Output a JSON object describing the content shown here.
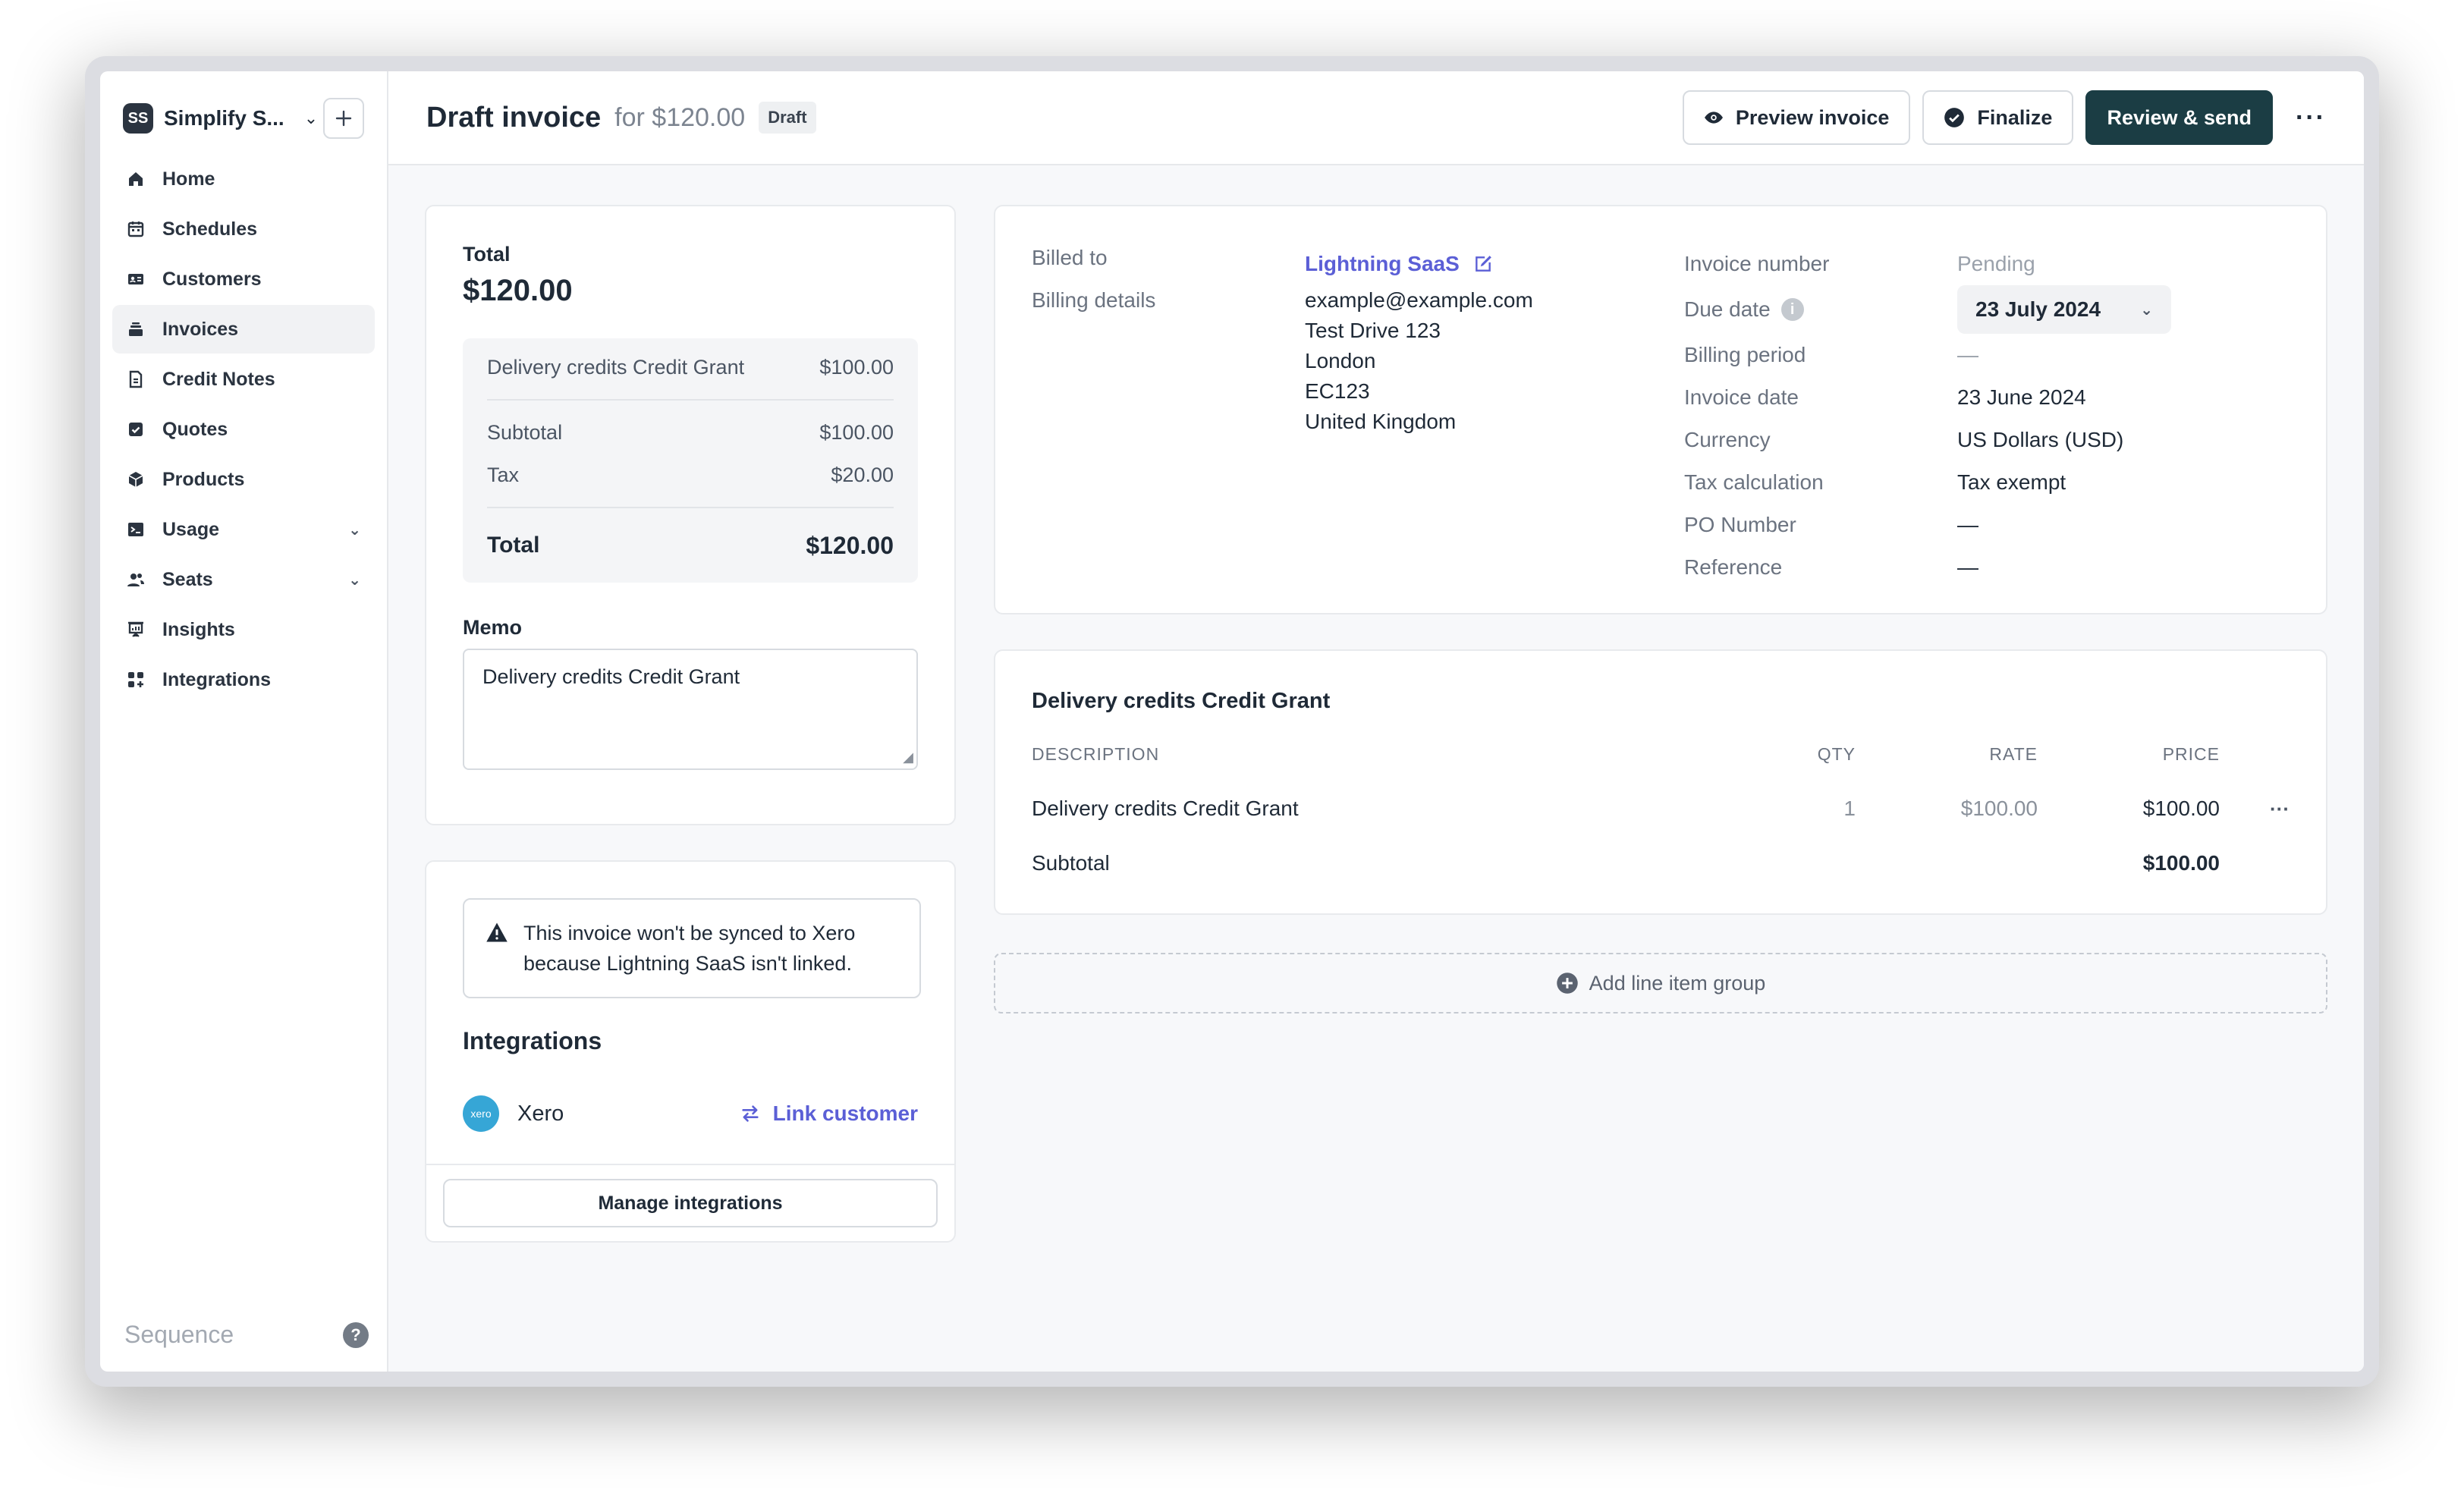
{
  "workspace": {
    "initials": "SS",
    "name": "Simplify S..."
  },
  "nav": [
    {
      "label": "Home",
      "icon": "home-icon"
    },
    {
      "label": "Schedules",
      "icon": "calendar-icon"
    },
    {
      "label": "Customers",
      "icon": "contact-card-icon"
    },
    {
      "label": "Invoices",
      "icon": "invoice-stack-icon",
      "active": true
    },
    {
      "label": "Credit Notes",
      "icon": "credit-note-icon"
    },
    {
      "label": "Quotes",
      "icon": "quote-check-icon"
    },
    {
      "label": "Products",
      "icon": "box-icon"
    },
    {
      "label": "Usage",
      "icon": "terminal-icon",
      "expandable": true
    },
    {
      "label": "Seats",
      "icon": "users-icon",
      "expandable": true
    },
    {
      "label": "Insights",
      "icon": "presentation-icon"
    },
    {
      "label": "Integrations",
      "icon": "grid-icon"
    }
  ],
  "footer": {
    "brand": "Sequence",
    "help": "?"
  },
  "header": {
    "title": "Draft invoice",
    "subtitle": "for $120.00",
    "status": "Draft",
    "preview_label": "Preview invoice",
    "finalize_label": "Finalize",
    "review_label": "Review & send",
    "more_label": "···"
  },
  "summary": {
    "total_label": "Total",
    "total_amount": "$120.00",
    "line_label": "Delivery credits Credit Grant",
    "line_amount": "$100.00",
    "subtotal_label": "Subtotal",
    "subtotal_amount": "$100.00",
    "tax_label": "Tax",
    "tax_amount": "$20.00",
    "grand_label": "Total",
    "grand_amount": "$120.00"
  },
  "memo": {
    "label": "Memo",
    "value": "Delivery credits Credit Grant"
  },
  "integrations": {
    "warning_line1": "This invoice won't be synced to Xero",
    "warning_line2": "because Lightning SaaS isn't linked.",
    "title": "Integrations",
    "xero_logo_text": "xero",
    "xero_name": "Xero",
    "link_label": "Link customer",
    "manage_label": "Manage integrations"
  },
  "billing": {
    "billed_to_label": "Billed to",
    "customer_name": "Lightning SaaS",
    "billing_details_label": "Billing details",
    "address": [
      "example@example.com",
      "Test Drive 123",
      "London",
      "EC123",
      "United Kingdom"
    ],
    "invoice_number_label": "Invoice number",
    "invoice_number_value": "Pending",
    "due_date_label": "Due date",
    "due_date_value": "23 July 2024",
    "billing_period_label": "Billing period",
    "billing_period_value": "—",
    "invoice_date_label": "Invoice date",
    "invoice_date_value": "23 June 2024",
    "currency_label": "Currency",
    "currency_value": "US Dollars (USD)",
    "tax_calc_label": "Tax calculation",
    "tax_calc_value": "Tax exempt",
    "po_label": "PO Number",
    "po_value": "—",
    "reference_label": "Reference",
    "reference_value": "—"
  },
  "line_items": {
    "group_title": "Delivery credits Credit Grant",
    "headers": {
      "description": "DESCRIPTION",
      "qty": "QTY",
      "rate": "RATE",
      "price": "PRICE"
    },
    "rows": [
      {
        "description": "Delivery credits Credit Grant",
        "qty": "1",
        "rate": "$100.00",
        "price": "$100.00"
      }
    ],
    "subtotal_label": "Subtotal",
    "subtotal_value": "$100.00",
    "row_more": "···"
  },
  "add_group_label": "Add line item group",
  "colors": {
    "primary": "#1b3d44",
    "link": "#5b5fd6",
    "xero": "#36a6d6"
  }
}
